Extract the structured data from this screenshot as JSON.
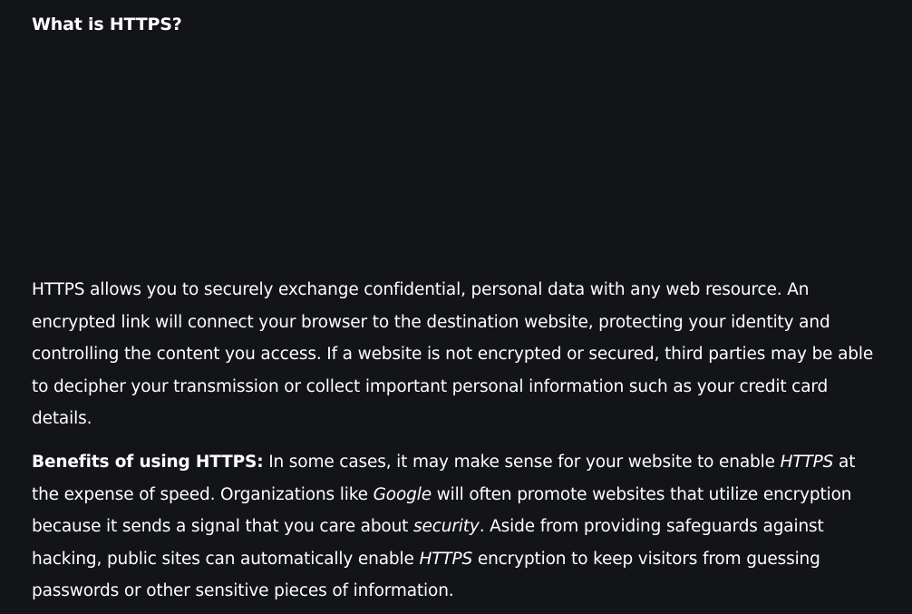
{
  "heading": "What is HTTPS?",
  "paragraph1": "HTTPS allows you to securely exchange confidential, personal data with any web resource. An encrypted link will connect your browser to the destination website, protecting your identity and controlling the content you access. If a website is not encrypted or secured, third parties may be able to decipher your transmission or collect important personal information such as your credit card details.",
  "paragraph2": {
    "lead": "Benefits of using HTTPS:",
    "t1": " In some cases, it may make sense for your website to enable ",
    "em1": "HTTPS",
    "t2": " at the expense of speed. Organizations like ",
    "em2": "Google",
    "t3": " will often promote websites that utilize encryption because it sends a signal that you care about ",
    "em3": "security",
    "t4": ". Aside from providing safeguards against hacking, public sites can automatically enable ",
    "em4": "HTTPS",
    "t5": " encryption to keep visitors from guessing passwords or other sensitive pieces of information."
  },
  "colors": {
    "background": "#131417",
    "text": "#ffffff"
  }
}
